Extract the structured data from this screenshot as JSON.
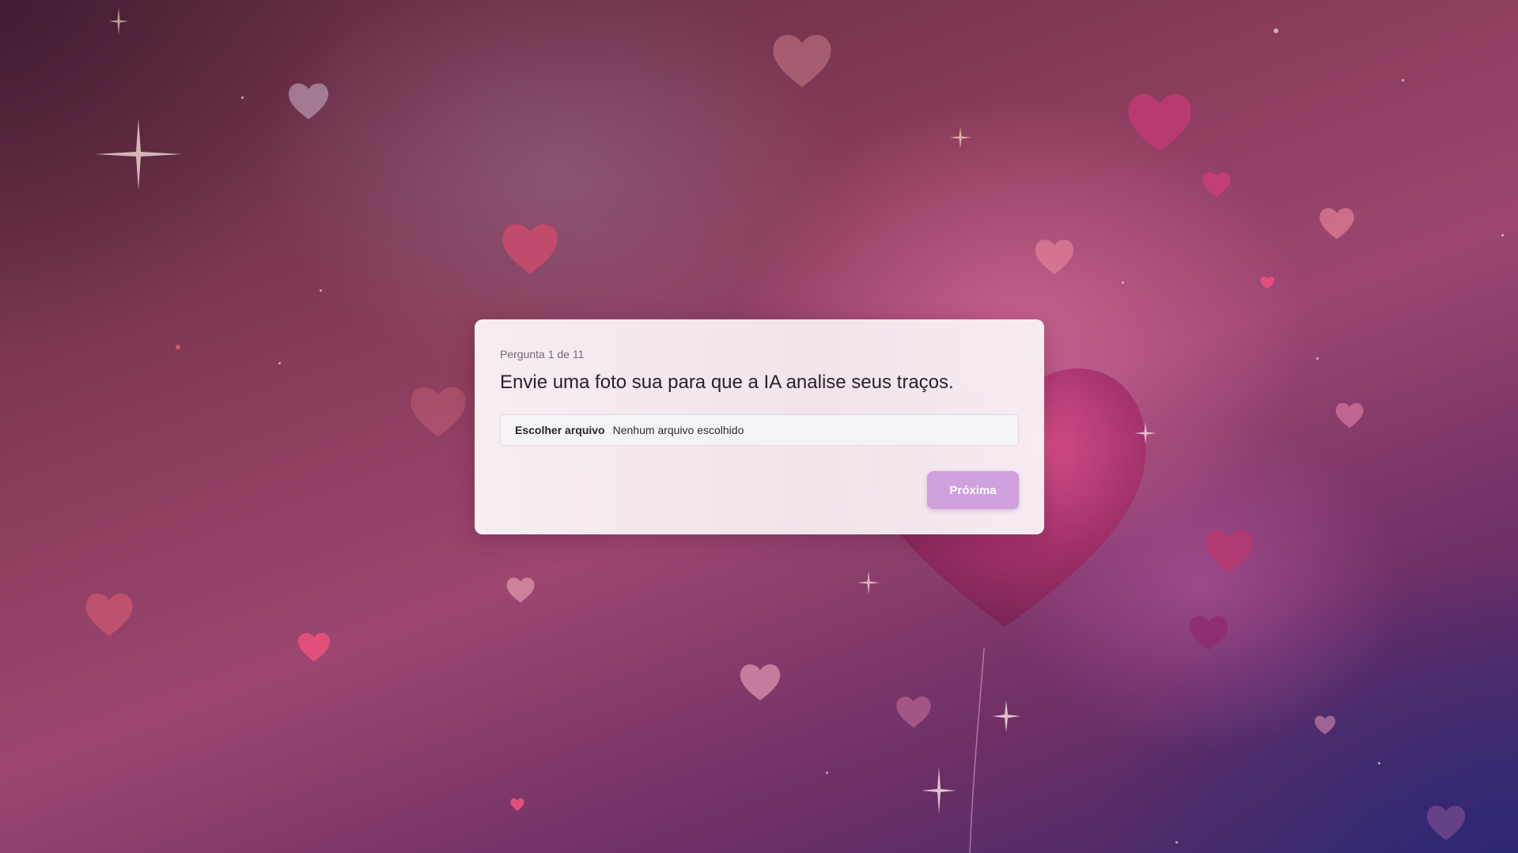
{
  "quiz": {
    "counter": "Pergunta 1 de 11",
    "question": "Envie uma foto sua para que a IA analise seus traços.",
    "file_input": {
      "button_label": "Escolher arquivo",
      "status": "Nenhum arquivo escolhido"
    },
    "next_label": "Próxima"
  },
  "colors": {
    "card_background": "#f7eef3",
    "button": "#cfa0dc",
    "text": "#262230",
    "background_pink": "#9c4670",
    "background_purple": "#3b2a6a"
  },
  "icons": {
    "background_hearts": "heart-icon",
    "background_sparkles": "sparkle-icon"
  }
}
